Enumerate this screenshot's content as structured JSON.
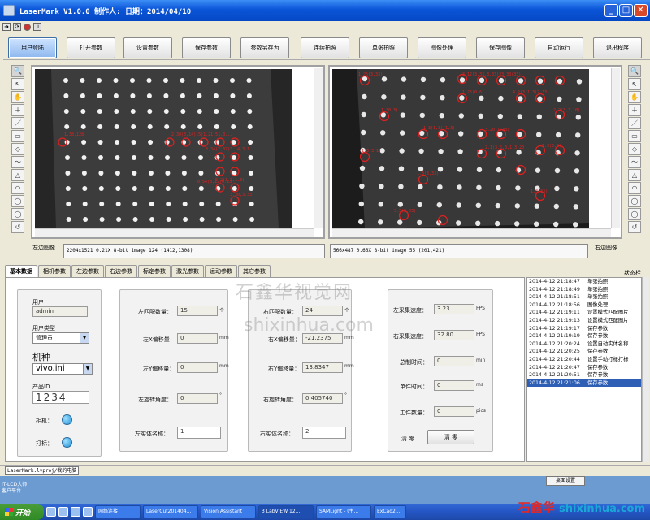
{
  "window": {
    "title": "LaserMark V1.0.0    制作人:           日期：2014/04/10"
  },
  "toolbar": {
    "buttons": [
      "用户登陆",
      "打开参数",
      "设置参数",
      "保存参数",
      "参数另存为",
      "连续拍照",
      "单张拍照",
      "图像处理",
      "保存图像",
      "自动运行",
      "退出程序"
    ]
  },
  "left_tools": [
    "🔍",
    "↖",
    "✋",
    "＋",
    "／",
    "▭",
    "◇",
    "〜",
    "△",
    "◠",
    "◯",
    "◯",
    "↺"
  ],
  "right_tools": [
    "🔍",
    "↖",
    "✋",
    "＋",
    "／",
    "▭",
    "◇",
    "〜",
    "△",
    "◠",
    "◯",
    "◯",
    "↺"
  ],
  "left_view": {
    "label": "左边图像",
    "info": "2204x1521 0.21X 8-bit image 124     (1412,1308)",
    "annotations": [
      "1.38,128",
      "2.30(3,14)15)1.21.51.3...",
      "3,34(2,37)3.14,3.1",
      "0.54(3,12)0.13",
      "5.2(3.3,1.3)",
      "3.30,3.33"
    ]
  },
  "right_view": {
    "label": "右边图像",
    "info": "566x487 0.66X 8-bit image 55     (201,421)",
    "annotations": [
      "1.26(3,33)",
      "3.12(3,33,3,33)33,33(33)",
      "1.26(0.6)",
      "4.2(3(1,3)2,33)",
      "2.2(3,3,10)",
      "1.30,3)",
      "1.3(1,3)(1,3)",
      "3.20(1.33)",
      "2.1(3.6,3,1)3.20",
      "1.3(3,3)",
      "1.3(3,1)",
      "1.3(3,33)",
      "1.3(33)",
      "3.3(3.33)"
    ]
  },
  "tabs": [
    "基本数据",
    "相机参数",
    "左边参数",
    "右边参数",
    "标定参数",
    "激光参数",
    "运动参数",
    "其它参数"
  ],
  "active_tab": 0,
  "user_panel": {
    "user_label": "用户",
    "user_value": "admin",
    "type_label": "用户类型",
    "type_value": "管理员",
    "machine_label": "机种",
    "machine_value": "vivo.ini",
    "product_label": "产品ID",
    "product_value": "1234",
    "camera_label": "相机：",
    "marker_label": "打标："
  },
  "left_panel": {
    "match_label": "左匹配数量：",
    "match_value": "15",
    "match_unit": "个",
    "x_label": "左X偏移量：",
    "x_value": "0",
    "x_unit": "mm",
    "y_label": "左Y偏移量：",
    "y_value": "0",
    "y_unit": "mm",
    "rot_label": "左旋转角度：",
    "rot_value": "0",
    "rot_unit": "°",
    "name_label": "左实体名称：",
    "name_value": "1"
  },
  "right_panel": {
    "match_label": "右匹配数量：",
    "match_value": "24",
    "match_unit": "个",
    "x_label": "右X偏移量：",
    "x_value": "-21.2375",
    "x_unit": "mm",
    "y_label": "右Y偏移量：",
    "y_value": "13.8347",
    "y_unit": "mm",
    "rot_label": "右旋转角度：",
    "rot_value": "0.405740",
    "rot_unit": "°",
    "name_label": "右实体名称：",
    "name_value": "2"
  },
  "stats_panel": {
    "left_fps_label": "左采集速度：",
    "left_fps_value": "3.23",
    "left_fps_unit": "FPS",
    "right_fps_label": "右采集速度：",
    "right_fps_value": "32.80",
    "right_fps_unit": "FPS",
    "total_label": "总制时间：",
    "total_value": "0",
    "total_unit": "min",
    "single_label": "单件时间：",
    "single_value": "0",
    "single_unit": "ms",
    "count_label": "工件数量：",
    "count_value": "0",
    "count_unit": "pics",
    "clear_label": "清  零",
    "clear_button": "清  零"
  },
  "log_header": "状态栏",
  "log": [
    {
      "t": "2014-4-12 21:18:47",
      "m": "单张拍照"
    },
    {
      "t": "2014-4-12 21:18:49",
      "m": "单张拍照"
    },
    {
      "t": "2014-4-12 21:18:51",
      "m": "单张拍照"
    },
    {
      "t": "2014-4-12 21:18:56",
      "m": "图像处理"
    },
    {
      "t": "2014-4-12 21:19:11",
      "m": "设置模式匹配图片"
    },
    {
      "t": "2014-4-12 21:19:13",
      "m": "设置模式匹配图片"
    },
    {
      "t": "2014-4-12 21:19:17",
      "m": "保存参数"
    },
    {
      "t": "2014-4-12 21:19:19",
      "m": "保存参数"
    },
    {
      "t": "2014-4-12 21:20:24",
      "m": "设置自动实体名称"
    },
    {
      "t": "2014-4-12 21:20:25",
      "m": "保存参数"
    },
    {
      "t": "2014-4-12 21:20:44",
      "m": "设置手动打标打标"
    },
    {
      "t": "2014-4-12 21:20:47",
      "m": "保存参数"
    },
    {
      "t": "2014-4-12 21:20:51",
      "m": "保存参数"
    },
    {
      "t": "2014-4-12 21:21:06",
      "m": "保存参数"
    }
  ],
  "log_selected": 13,
  "status": {
    "path": "LaserMark.lvproj/我的电脑"
  },
  "watermark": {
    "cn": "石鑫华视觉网",
    "url": "shixinhua.com"
  },
  "desktop": {
    "corner": "IT-LCD大师\n客户平台",
    "button": "桌面设置"
  },
  "taskbar": {
    "start": "开始",
    "tasks": [
      "网络连接",
      "LaserCut201404...",
      "Vision Assistant",
      "3 LabVIEW 12...",
      "SAMLight - (主...",
      "ExCad2..."
    ]
  },
  "brand": {
    "cn": "石鑫华",
    "url": "shixinhua.com"
  },
  "colors": {
    "title_blue": "#0a55d8",
    "annotation_red": "#e02020",
    "selection_blue": "#2f5fb5",
    "led_blue": "#1f8fd6"
  }
}
